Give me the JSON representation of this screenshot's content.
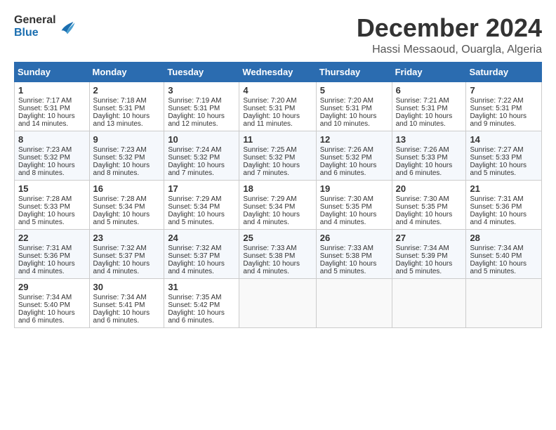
{
  "header": {
    "logo_general": "General",
    "logo_blue": "Blue",
    "month_title": "December 2024",
    "location": "Hassi Messaoud, Ouargla, Algeria"
  },
  "calendar": {
    "days_of_week": [
      "Sunday",
      "Monday",
      "Tuesday",
      "Wednesday",
      "Thursday",
      "Friday",
      "Saturday"
    ],
    "weeks": [
      [
        {
          "day": "",
          "content": ""
        },
        {
          "day": "2",
          "content": "Sunrise: 7:18 AM\nSunset: 5:31 PM\nDaylight: 10 hours\nand 13 minutes."
        },
        {
          "day": "3",
          "content": "Sunrise: 7:19 AM\nSunset: 5:31 PM\nDaylight: 10 hours\nand 12 minutes."
        },
        {
          "day": "4",
          "content": "Sunrise: 7:20 AM\nSunset: 5:31 PM\nDaylight: 10 hours\nand 11 minutes."
        },
        {
          "day": "5",
          "content": "Sunrise: 7:20 AM\nSunset: 5:31 PM\nDaylight: 10 hours\nand 10 minutes."
        },
        {
          "day": "6",
          "content": "Sunrise: 7:21 AM\nSunset: 5:31 PM\nDaylight: 10 hours\nand 10 minutes."
        },
        {
          "day": "7",
          "content": "Sunrise: 7:22 AM\nSunset: 5:31 PM\nDaylight: 10 hours\nand 9 minutes."
        }
      ],
      [
        {
          "day": "1",
          "content": "Sunrise: 7:17 AM\nSunset: 5:31 PM\nDaylight: 10 hours\nand 14 minutes."
        },
        {
          "day": "9",
          "content": "Sunrise: 7:23 AM\nSunset: 5:32 PM\nDaylight: 10 hours\nand 8 minutes."
        },
        {
          "day": "10",
          "content": "Sunrise: 7:24 AM\nSunset: 5:32 PM\nDaylight: 10 hours\nand 7 minutes."
        },
        {
          "day": "11",
          "content": "Sunrise: 7:25 AM\nSunset: 5:32 PM\nDaylight: 10 hours\nand 7 minutes."
        },
        {
          "day": "12",
          "content": "Sunrise: 7:26 AM\nSunset: 5:32 PM\nDaylight: 10 hours\nand 6 minutes."
        },
        {
          "day": "13",
          "content": "Sunrise: 7:26 AM\nSunset: 5:33 PM\nDaylight: 10 hours\nand 6 minutes."
        },
        {
          "day": "14",
          "content": "Sunrise: 7:27 AM\nSunset: 5:33 PM\nDaylight: 10 hours\nand 5 minutes."
        }
      ],
      [
        {
          "day": "8",
          "content": "Sunrise: 7:23 AM\nSunset: 5:32 PM\nDaylight: 10 hours\nand 8 minutes."
        },
        {
          "day": "16",
          "content": "Sunrise: 7:28 AM\nSunset: 5:34 PM\nDaylight: 10 hours\nand 5 minutes."
        },
        {
          "day": "17",
          "content": "Sunrise: 7:29 AM\nSunset: 5:34 PM\nDaylight: 10 hours\nand 5 minutes."
        },
        {
          "day": "18",
          "content": "Sunrise: 7:29 AM\nSunset: 5:34 PM\nDaylight: 10 hours\nand 4 minutes."
        },
        {
          "day": "19",
          "content": "Sunrise: 7:30 AM\nSunset: 5:35 PM\nDaylight: 10 hours\nand 4 minutes."
        },
        {
          "day": "20",
          "content": "Sunrise: 7:30 AM\nSunset: 5:35 PM\nDaylight: 10 hours\nand 4 minutes."
        },
        {
          "day": "21",
          "content": "Sunrise: 7:31 AM\nSunset: 5:36 PM\nDaylight: 10 hours\nand 4 minutes."
        }
      ],
      [
        {
          "day": "15",
          "content": "Sunrise: 7:28 AM\nSunset: 5:33 PM\nDaylight: 10 hours\nand 5 minutes."
        },
        {
          "day": "23",
          "content": "Sunrise: 7:32 AM\nSunset: 5:37 PM\nDaylight: 10 hours\nand 4 minutes."
        },
        {
          "day": "24",
          "content": "Sunrise: 7:32 AM\nSunset: 5:37 PM\nDaylight: 10 hours\nand 4 minutes."
        },
        {
          "day": "25",
          "content": "Sunrise: 7:33 AM\nSunset: 5:38 PM\nDaylight: 10 hours\nand 4 minutes."
        },
        {
          "day": "26",
          "content": "Sunrise: 7:33 AM\nSunset: 5:38 PM\nDaylight: 10 hours\nand 5 minutes."
        },
        {
          "day": "27",
          "content": "Sunrise: 7:34 AM\nSunset: 5:39 PM\nDaylight: 10 hours\nand 5 minutes."
        },
        {
          "day": "28",
          "content": "Sunrise: 7:34 AM\nSunset: 5:40 PM\nDaylight: 10 hours\nand 5 minutes."
        }
      ],
      [
        {
          "day": "22",
          "content": "Sunrise: 7:31 AM\nSunset: 5:36 PM\nDaylight: 10 hours\nand 4 minutes."
        },
        {
          "day": "30",
          "content": "Sunrise: 7:34 AM\nSunset: 5:41 PM\nDaylight: 10 hours\nand 6 minutes."
        },
        {
          "day": "31",
          "content": "Sunrise: 7:35 AM\nSunset: 5:42 PM\nDaylight: 10 hours\nand 6 minutes."
        },
        {
          "day": "",
          "content": ""
        },
        {
          "day": "",
          "content": ""
        },
        {
          "day": "",
          "content": ""
        },
        {
          "day": "",
          "content": ""
        }
      ],
      [
        {
          "day": "29",
          "content": "Sunrise: 7:34 AM\nSunset: 5:40 PM\nDaylight: 10 hours\nand 6 minutes."
        },
        {
          "day": "",
          "content": ""
        },
        {
          "day": "",
          "content": ""
        },
        {
          "day": "",
          "content": ""
        },
        {
          "day": "",
          "content": ""
        },
        {
          "day": "",
          "content": ""
        },
        {
          "day": "",
          "content": ""
        }
      ]
    ]
  }
}
